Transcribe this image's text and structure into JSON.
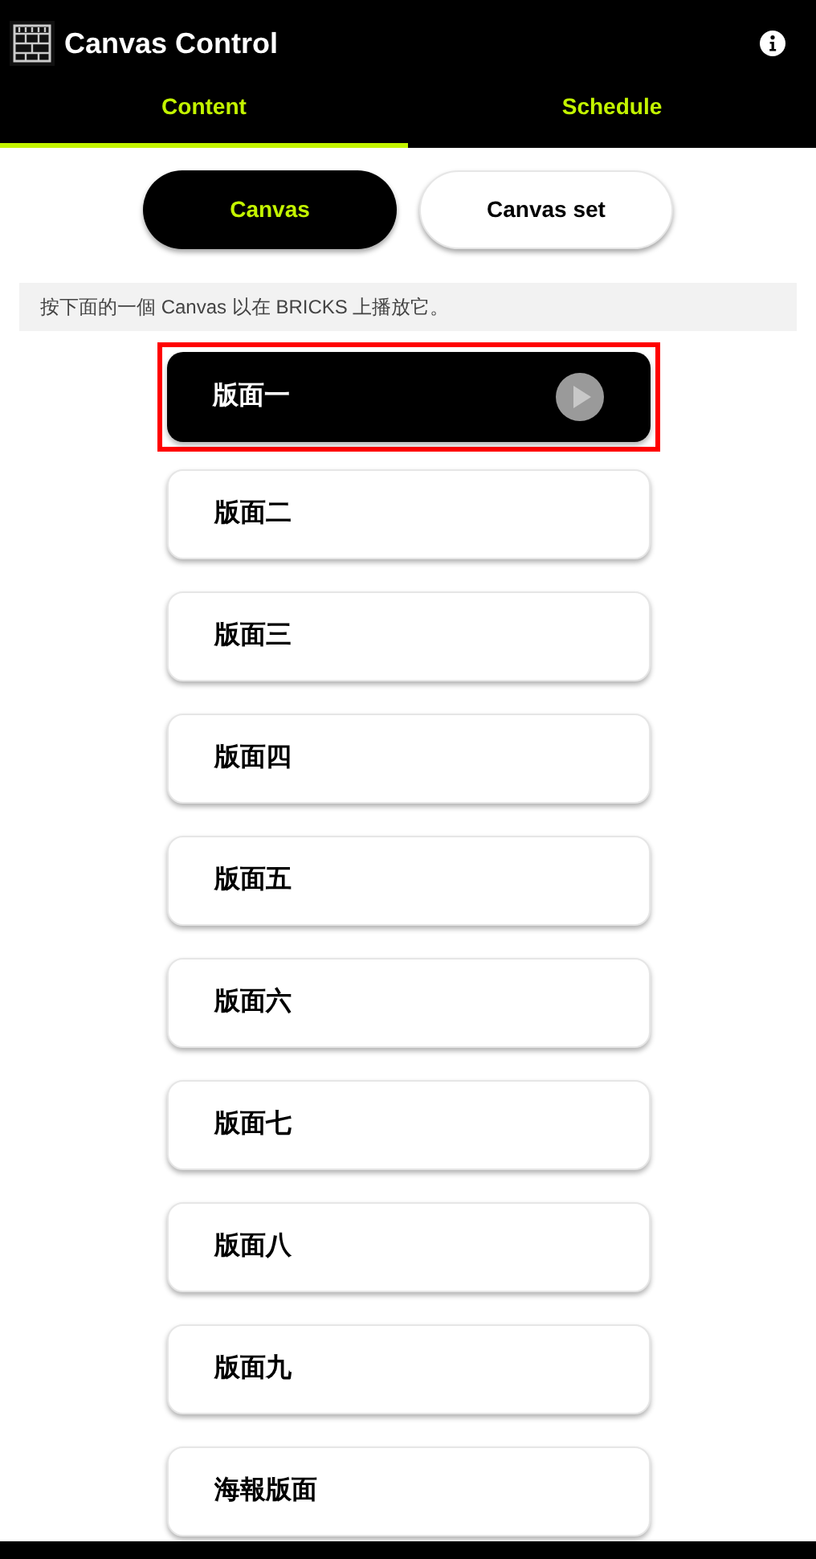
{
  "app_bar": {
    "title": "Canvas Control"
  },
  "tabs": [
    {
      "label": "Content",
      "selected": true
    },
    {
      "label": "Schedule",
      "selected": false
    }
  ],
  "segments": [
    {
      "label": "Canvas",
      "selected": true
    },
    {
      "label": "Canvas set",
      "selected": false
    }
  ],
  "hint": "按下面的一個 Canvas 以在 BRICKS 上播放它。",
  "canvases": [
    {
      "label": "版面一",
      "selected": true
    },
    {
      "label": "版面二",
      "selected": false
    },
    {
      "label": "版面三",
      "selected": false
    },
    {
      "label": "版面四",
      "selected": false
    },
    {
      "label": "版面五",
      "selected": false
    },
    {
      "label": "版面六",
      "selected": false
    },
    {
      "label": "版面七",
      "selected": false
    },
    {
      "label": "版面八",
      "selected": false
    },
    {
      "label": "版面九",
      "selected": false
    },
    {
      "label": "海報版面",
      "selected": false
    }
  ]
}
